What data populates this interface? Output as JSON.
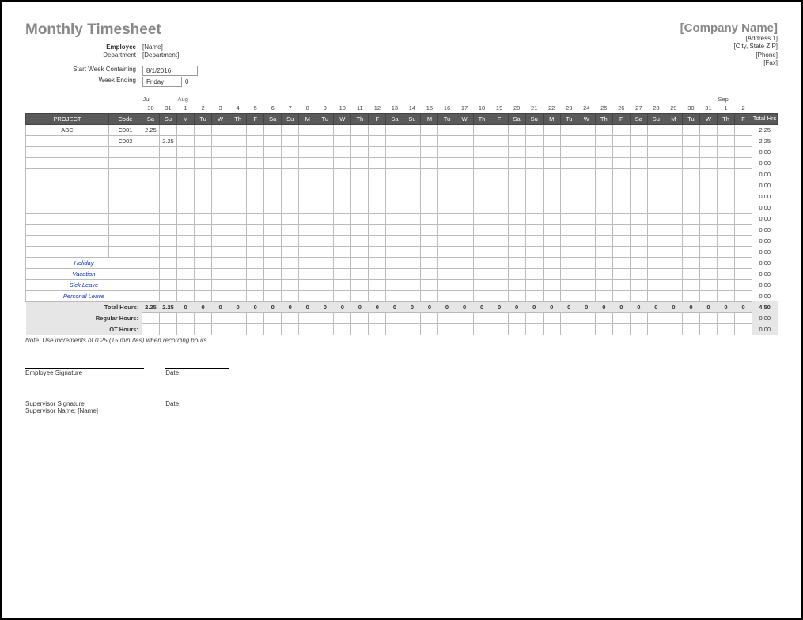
{
  "title": "Monthly Timesheet",
  "company": {
    "name": "[Company Name]",
    "addr1": "[Address 1]",
    "addr2": "[City, State ZIP]",
    "phone": "[Phone]",
    "fax": "[Fax]"
  },
  "info": {
    "empLabel": "Employee",
    "emp": "[Name]",
    "deptLabel": "Department",
    "dept": "[Department]",
    "swcLabel": "Start Week Containing",
    "swc": "8/1/2016",
    "weLabel": "Week Ending",
    "we": "Friday",
    "we2": "0"
  },
  "months": [
    "",
    "",
    "Jul",
    "",
    "Aug",
    "",
    "",
    "",
    "",
    "",
    "",
    "",
    "",
    "",
    "",
    "",
    "",
    "",
    "",
    "",
    "",
    "",
    "",
    "",
    "",
    "",
    "",
    "",
    "",
    "",
    "",
    "",
    "",
    "",
    "",
    "Sep",
    "",
    ""
  ],
  "daynums": [
    "",
    "",
    "30",
    "31",
    "1",
    "2",
    "3",
    "4",
    "5",
    "6",
    "7",
    "8",
    "9",
    "10",
    "11",
    "12",
    "13",
    "14",
    "15",
    "16",
    "17",
    "18",
    "19",
    "20",
    "21",
    "22",
    "23",
    "24",
    "25",
    "26",
    "27",
    "28",
    "29",
    "30",
    "31",
    "1",
    "2",
    ""
  ],
  "daynames": [
    "PROJECT",
    "Code",
    "Sa",
    "Su",
    "M",
    "Tu",
    "W",
    "Th",
    "F",
    "Sa",
    "Su",
    "M",
    "Tu",
    "W",
    "Th",
    "F",
    "Sa",
    "Su",
    "M",
    "Tu",
    "W",
    "Th",
    "F",
    "Sa",
    "Su",
    "M",
    "Tu",
    "W",
    "Th",
    "F",
    "Sa",
    "Su",
    "M",
    "Tu",
    "W",
    "Th",
    "F",
    "Total Hrs"
  ],
  "rows": [
    {
      "proj": "ABC",
      "code": "C001",
      "vals": [
        "2.25",
        "",
        "",
        "",
        "",
        "",
        "",
        "",
        "",
        "",
        "",
        "",
        "",
        "",
        "",
        "",
        "",
        "",
        "",
        "",
        "",
        "",
        "",
        "",
        "",
        "",
        "",
        "",
        "",
        "",
        "",
        "",
        "",
        "",
        ""
      ],
      "total": "2.25"
    },
    {
      "proj": "",
      "code": "C002",
      "vals": [
        "",
        "2.25",
        "",
        "",
        "",
        "",
        "",
        "",
        "",
        "",
        "",
        "",
        "",
        "",
        "",
        "",
        "",
        "",
        "",
        "",
        "",
        "",
        "",
        "",
        "",
        "",
        "",
        "",
        "",
        "",
        "",
        "",
        "",
        "",
        ""
      ],
      "total": "2.25"
    },
    {
      "proj": "",
      "code": "",
      "vals": [
        "",
        "",
        "",
        "",
        "",
        "",
        "",
        "",
        "",
        "",
        "",
        "",
        "",
        "",
        "",
        "",
        "",
        "",
        "",
        "",
        "",
        "",
        "",
        "",
        "",
        "",
        "",
        "",
        "",
        "",
        "",
        "",
        "",
        "",
        ""
      ],
      "total": "0.00"
    },
    {
      "proj": "",
      "code": "",
      "vals": [
        "",
        "",
        "",
        "",
        "",
        "",
        "",
        "",
        "",
        "",
        "",
        "",
        "",
        "",
        "",
        "",
        "",
        "",
        "",
        "",
        "",
        "",
        "",
        "",
        "",
        "",
        "",
        "",
        "",
        "",
        "",
        "",
        "",
        "",
        ""
      ],
      "total": "0.00"
    },
    {
      "proj": "",
      "code": "",
      "vals": [
        "",
        "",
        "",
        "",
        "",
        "",
        "",
        "",
        "",
        "",
        "",
        "",
        "",
        "",
        "",
        "",
        "",
        "",
        "",
        "",
        "",
        "",
        "",
        "",
        "",
        "",
        "",
        "",
        "",
        "",
        "",
        "",
        "",
        "",
        ""
      ],
      "total": "0.00"
    },
    {
      "proj": "",
      "code": "",
      "vals": [
        "",
        "",
        "",
        "",
        "",
        "",
        "",
        "",
        "",
        "",
        "",
        "",
        "",
        "",
        "",
        "",
        "",
        "",
        "",
        "",
        "",
        "",
        "",
        "",
        "",
        "",
        "",
        "",
        "",
        "",
        "",
        "",
        "",
        "",
        ""
      ],
      "total": "0.00"
    },
    {
      "proj": "",
      "code": "",
      "vals": [
        "",
        "",
        "",
        "",
        "",
        "",
        "",
        "",
        "",
        "",
        "",
        "",
        "",
        "",
        "",
        "",
        "",
        "",
        "",
        "",
        "",
        "",
        "",
        "",
        "",
        "",
        "",
        "",
        "",
        "",
        "",
        "",
        "",
        "",
        ""
      ],
      "total": "0.00"
    },
    {
      "proj": "",
      "code": "",
      "vals": [
        "",
        "",
        "",
        "",
        "",
        "",
        "",
        "",
        "",
        "",
        "",
        "",
        "",
        "",
        "",
        "",
        "",
        "",
        "",
        "",
        "",
        "",
        "",
        "",
        "",
        "",
        "",
        "",
        "",
        "",
        "",
        "",
        "",
        "",
        ""
      ],
      "total": "0.00"
    },
    {
      "proj": "",
      "code": "",
      "vals": [
        "",
        "",
        "",
        "",
        "",
        "",
        "",
        "",
        "",
        "",
        "",
        "",
        "",
        "",
        "",
        "",
        "",
        "",
        "",
        "",
        "",
        "",
        "",
        "",
        "",
        "",
        "",
        "",
        "",
        "",
        "",
        "",
        "",
        "",
        ""
      ],
      "total": "0.00"
    },
    {
      "proj": "",
      "code": "",
      "vals": [
        "",
        "",
        "",
        "",
        "",
        "",
        "",
        "",
        "",
        "",
        "",
        "",
        "",
        "",
        "",
        "",
        "",
        "",
        "",
        "",
        "",
        "",
        "",
        "",
        "",
        "",
        "",
        "",
        "",
        "",
        "",
        "",
        "",
        "",
        ""
      ],
      "total": "0.00"
    },
    {
      "proj": "",
      "code": "",
      "vals": [
        "",
        "",
        "",
        "",
        "",
        "",
        "",
        "",
        "",
        "",
        "",
        "",
        "",
        "",
        "",
        "",
        "",
        "",
        "",
        "",
        "",
        "",
        "",
        "",
        "",
        "",
        "",
        "",
        "",
        "",
        "",
        "",
        "",
        "",
        ""
      ],
      "total": "0.00"
    },
    {
      "proj": "",
      "code": "",
      "vals": [
        "",
        "",
        "",
        "",
        "",
        "",
        "",
        "",
        "",
        "",
        "",
        "",
        "",
        "",
        "",
        "",
        "",
        "",
        "",
        "",
        "",
        "",
        "",
        "",
        "",
        "",
        "",
        "",
        "",
        "",
        "",
        "",
        "",
        "",
        ""
      ],
      "total": "0.00"
    }
  ],
  "special": [
    {
      "proj": "Holiday",
      "total": "0.00"
    },
    {
      "proj": "Vacation",
      "total": "0.00"
    },
    {
      "proj": "Sick Leave",
      "total": "0.00"
    },
    {
      "proj": "Personal Leave",
      "total": "0.00"
    }
  ],
  "totals": {
    "label": "Total Hours:",
    "vals": [
      "2.25",
      "2.25",
      "0",
      "0",
      "0",
      "0",
      "0",
      "0",
      "0",
      "0",
      "0",
      "0",
      "0",
      "0",
      "0",
      "0",
      "0",
      "0",
      "0",
      "0",
      "0",
      "0",
      "0",
      "0",
      "0",
      "0",
      "0",
      "0",
      "0",
      "0",
      "0",
      "0",
      "0",
      "0",
      "0"
    ],
    "total": "4.50"
  },
  "reg": {
    "label": "Regular Hours:",
    "total": "0.00"
  },
  "ot": {
    "label": "OT Hours:",
    "total": "0.00"
  },
  "note": "Note: Use increments of 0.25 (15 minutes) when recording hours.",
  "sigs": {
    "emp": "Employee Signature",
    "date": "Date",
    "sup": "Supervisor Signature",
    "supname": "Supervisor Name: [Name]"
  }
}
